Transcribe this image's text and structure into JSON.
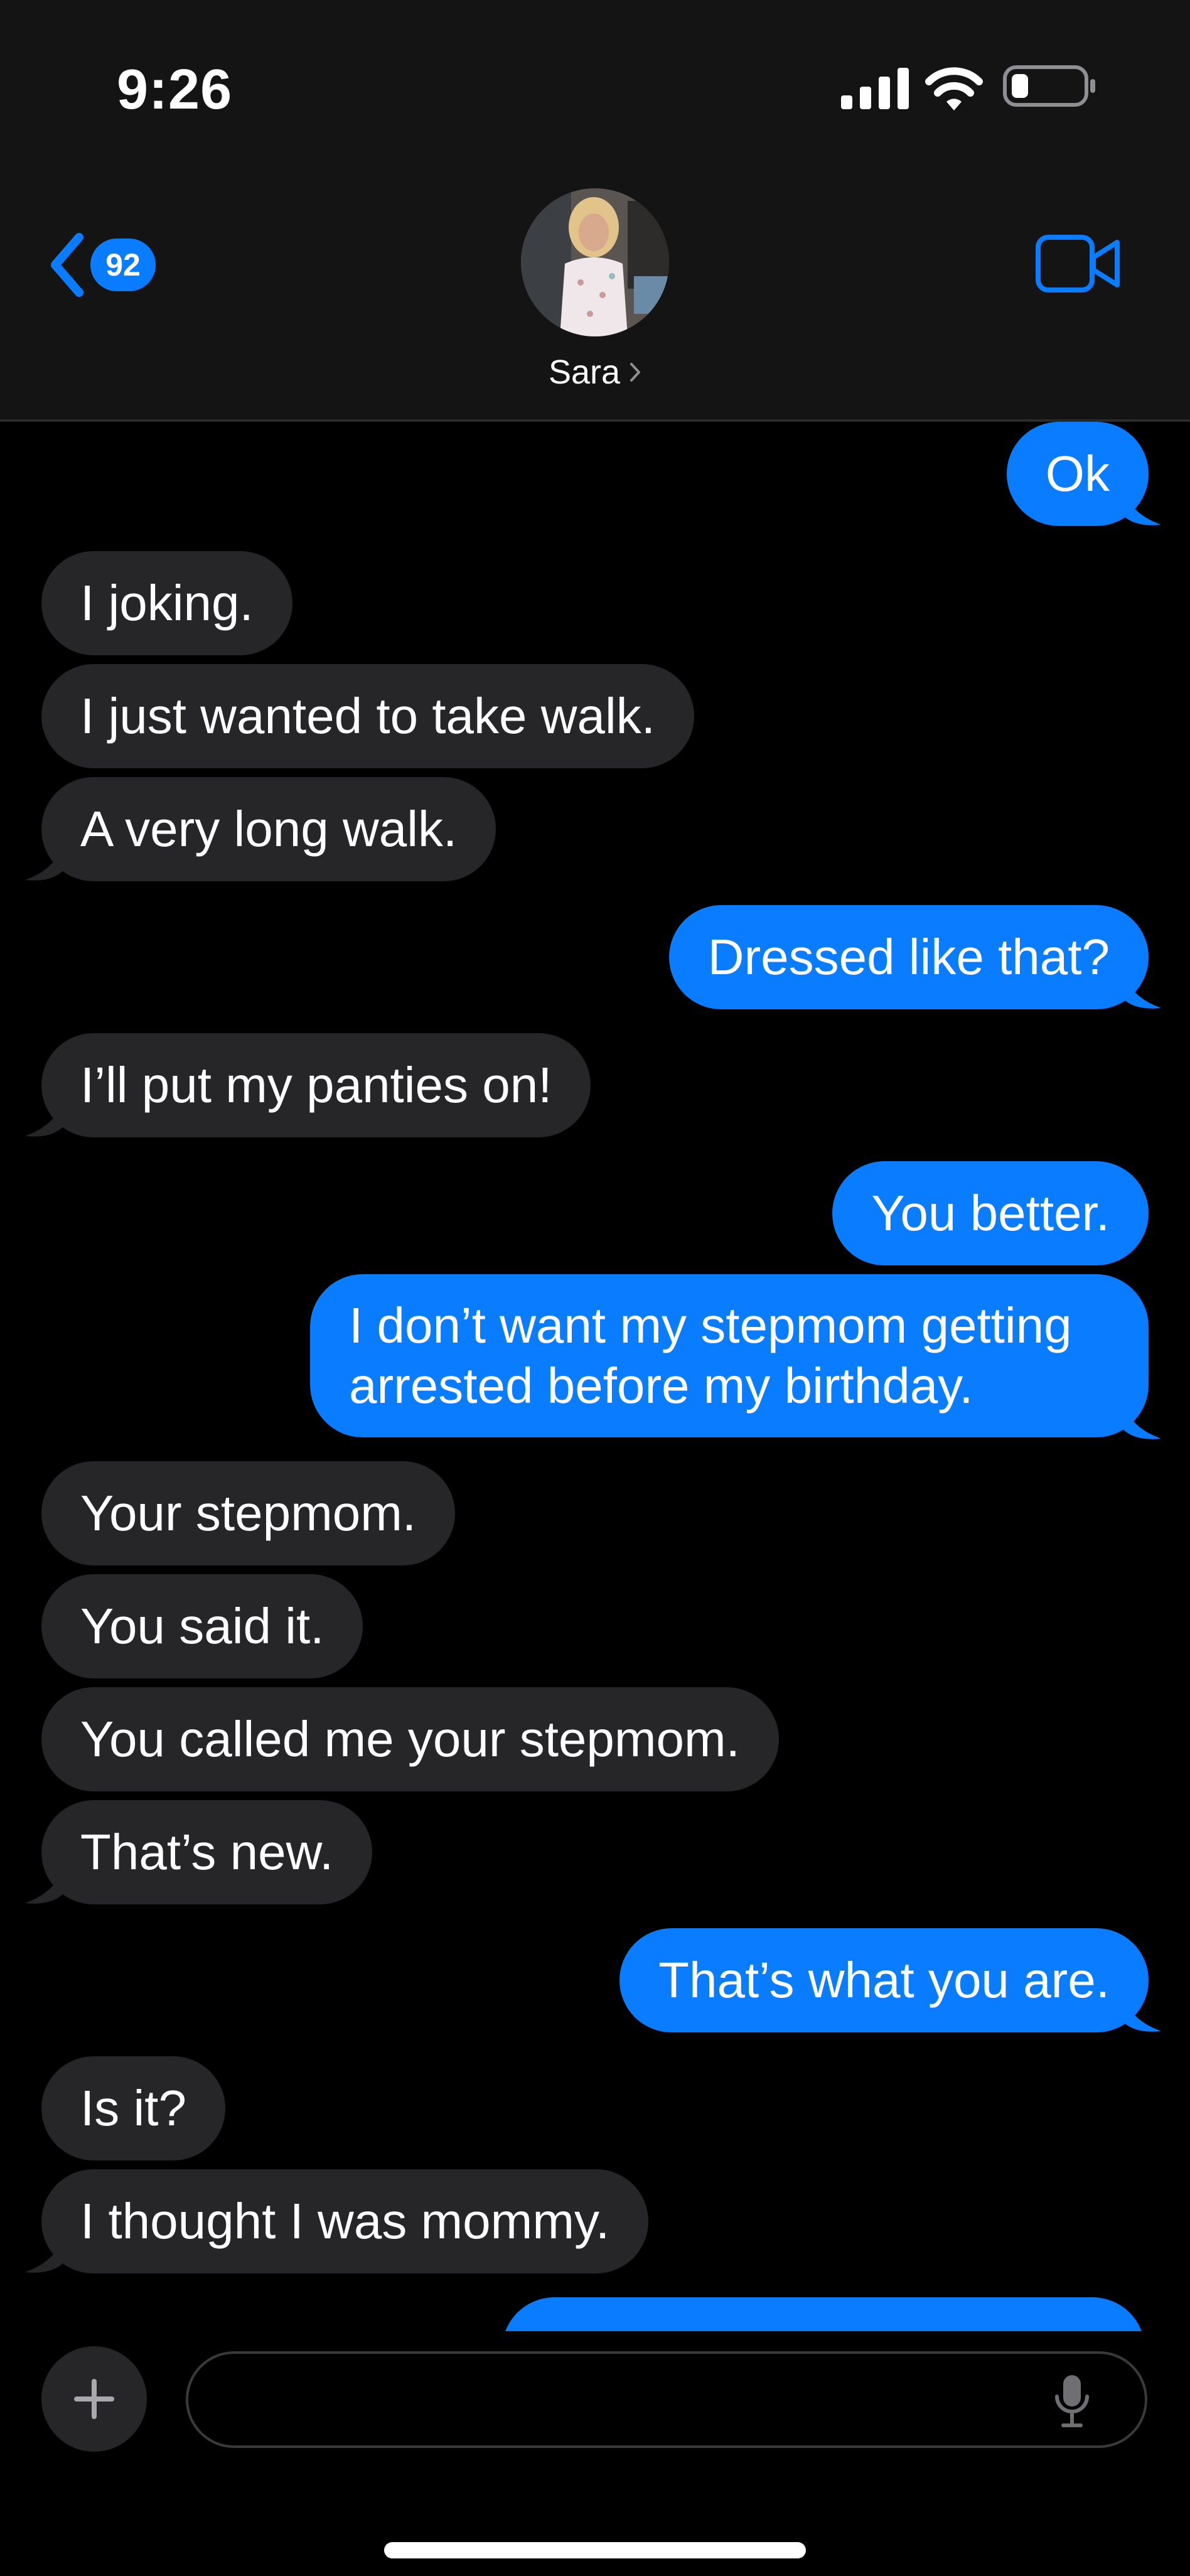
{
  "status_bar": {
    "time": "9:26"
  },
  "header": {
    "back_count": "92",
    "contact_name": "Sara"
  },
  "messages": [
    {
      "side": "sent",
      "text": "Ok"
    },
    {
      "side": "received",
      "text": "I joking."
    },
    {
      "side": "received",
      "text": "I just wanted to take walk."
    },
    {
      "side": "received",
      "text": "A very long walk."
    },
    {
      "side": "sent",
      "text": "Dressed like that?"
    },
    {
      "side": "received",
      "text": "I’ll put my panties on!"
    },
    {
      "side": "sent",
      "text": "You better."
    },
    {
      "side": "sent",
      "text": "I don’t want my stepmom getting arrested before my birthday."
    },
    {
      "side": "received",
      "text": "Your stepmom."
    },
    {
      "side": "received",
      "text": "You said it."
    },
    {
      "side": "received",
      "text": "You called me your stepmom."
    },
    {
      "side": "received",
      "text": "That’s new."
    },
    {
      "side": "sent",
      "text": "That’s what you are."
    },
    {
      "side": "received",
      "text": "Is it?"
    },
    {
      "side": "received",
      "text": "I thought I was mommy."
    }
  ],
  "composer": {
    "placeholder": ""
  },
  "colors": {
    "sent_bubble": "#0a7cff",
    "received_bubble": "#262628",
    "accent": "#0a7cff",
    "background": "#000000"
  }
}
